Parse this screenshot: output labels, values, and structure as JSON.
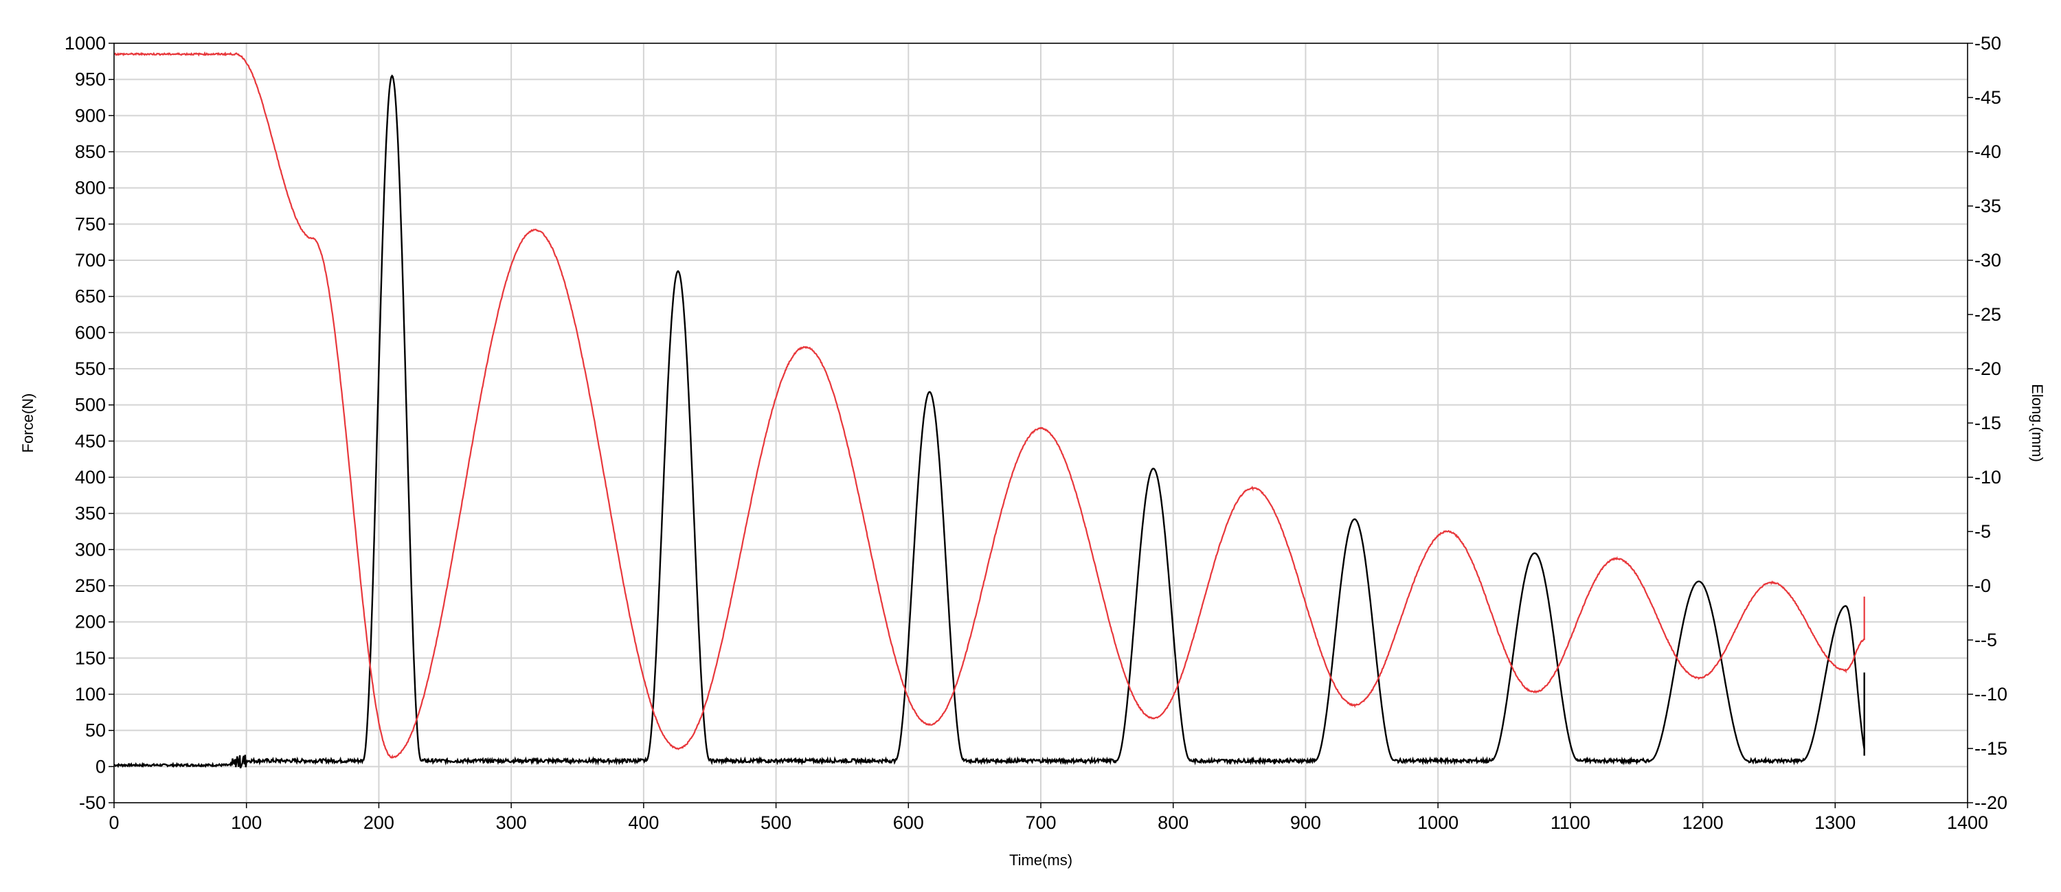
{
  "chart_data": {
    "type": "line",
    "xlabel": "Time(ms)",
    "ylabel_left": "Force(N)",
    "ylabel_right": "Elong.(mm)",
    "xlim": [
      0,
      1400
    ],
    "ylim_left": [
      -50,
      1000
    ],
    "ylim_right": [
      -20,
      50
    ],
    "x_ticks": [
      0,
      100,
      200,
      300,
      400,
      500,
      600,
      700,
      800,
      900,
      1000,
      1100,
      1200,
      1300,
      1400
    ],
    "y_left_ticks": [
      -50,
      0,
      50,
      100,
      150,
      200,
      250,
      300,
      350,
      400,
      450,
      500,
      550,
      600,
      650,
      700,
      750,
      800,
      850,
      900,
      950,
      1000
    ],
    "y_right_ticks": [
      -20,
      -15,
      -10,
      -5,
      0,
      5,
      10,
      15,
      20,
      25,
      30,
      35,
      40,
      45,
      50
    ],
    "grid": true,
    "series": [
      {
        "color": "#000000",
        "axis": "left",
        "baseline": 8,
        "peaks": [
          {
            "t": 210,
            "value": 955,
            "start": 188,
            "end": 232
          },
          {
            "t": 426,
            "value": 685,
            "start": 402,
            "end": 450
          },
          {
            "t": 616,
            "value": 518,
            "start": 590,
            "end": 642
          },
          {
            "t": 785,
            "value": 412,
            "start": 757,
            "end": 813
          },
          {
            "t": 937,
            "value": 342,
            "start": 907,
            "end": 967
          },
          {
            "t": 1073,
            "value": 295,
            "start": 1040,
            "end": 1106
          },
          {
            "t": 1197,
            "value": 256,
            "start": 1160,
            "end": 1234
          },
          {
            "t": 1308,
            "value": 222,
            "start": 1275,
            "end": 1325
          }
        ]
      },
      {
        "color": "#e8383c",
        "axis": "right",
        "start_value": 49,
        "release_t": 92,
        "points": [
          [
            0,
            49
          ],
          [
            92,
            49
          ],
          [
            150,
            32
          ],
          [
            210,
            -15.8
          ],
          [
            318,
            32.8
          ],
          [
            426,
            -15
          ],
          [
            522,
            22
          ],
          [
            616,
            -12.8
          ],
          [
            700,
            14.5
          ],
          [
            785,
            -12.2
          ],
          [
            860,
            9
          ],
          [
            937,
            -11
          ],
          [
            1007,
            5
          ],
          [
            1073,
            -9.8
          ],
          [
            1135,
            2.5
          ],
          [
            1197,
            -8.5
          ],
          [
            1252,
            0.3
          ],
          [
            1308,
            -7.8
          ],
          [
            1322,
            -5
          ]
        ]
      }
    ]
  }
}
